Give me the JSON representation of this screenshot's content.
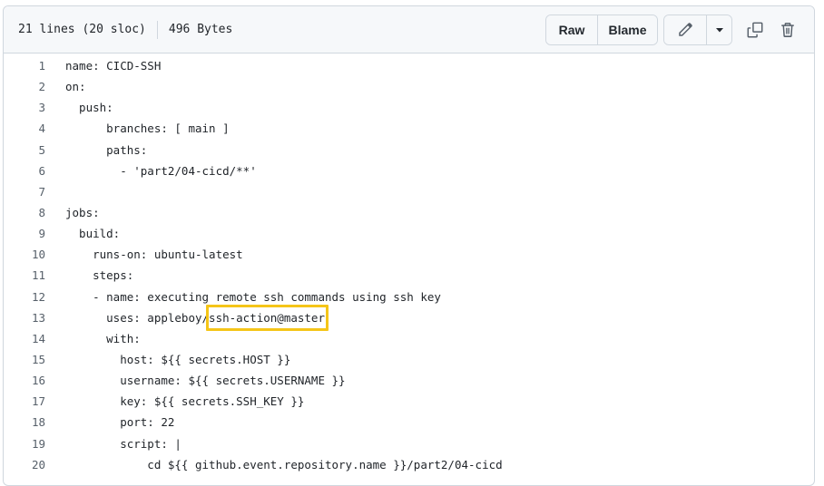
{
  "header": {
    "lines_info": "21 lines (20 sloc)",
    "size_info": "496 Bytes",
    "raw_label": "Raw",
    "blame_label": "Blame"
  },
  "colors": {
    "highlight": "#f5c518",
    "header_bg": "#f6f8fa",
    "border": "#d0d7de"
  },
  "icons": [
    "pencil-icon",
    "triangle-down-icon",
    "copy-icon",
    "trash-icon"
  ],
  "code": [
    {
      "n": "1",
      "t": "name: CICD-SSH"
    },
    {
      "n": "2",
      "t": "on:"
    },
    {
      "n": "3",
      "t": "  push:"
    },
    {
      "n": "4",
      "t": "      branches: [ main ]"
    },
    {
      "n": "5",
      "t": "      paths:"
    },
    {
      "n": "6",
      "t": "        - 'part2/04-cicd/**'"
    },
    {
      "n": "7",
      "t": ""
    },
    {
      "n": "8",
      "t": "jobs:"
    },
    {
      "n": "9",
      "t": "  build:"
    },
    {
      "n": "10",
      "t": "    runs-on: ubuntu-latest"
    },
    {
      "n": "11",
      "t": "    steps:"
    },
    {
      "n": "12",
      "t": "    - name: executing remote ssh commands using ssh key"
    },
    {
      "n": "13",
      "t_pre": "      uses: appleboy/",
      "t_hl": "ssh-action@master"
    },
    {
      "n": "14",
      "t": "      with:"
    },
    {
      "n": "15",
      "t": "        host: ${{ secrets.HOST }}"
    },
    {
      "n": "16",
      "t": "        username: ${{ secrets.USERNAME }}"
    },
    {
      "n": "17",
      "t": "        key: ${{ secrets.SSH_KEY }}"
    },
    {
      "n": "18",
      "t": "        port: 22"
    },
    {
      "n": "19",
      "t": "        script: |"
    },
    {
      "n": "20",
      "t": "            cd ${{ github.event.repository.name }}/part2/04-cicd"
    }
  ]
}
